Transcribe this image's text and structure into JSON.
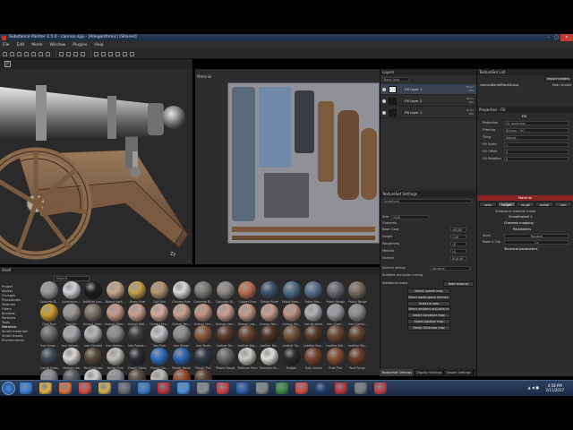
{
  "window": {
    "title": "Substance Painter 2.5.0 - cannon.spp - [Allegorithmic] [Shared]",
    "controls": [
      "–",
      "▢",
      "✕"
    ]
  },
  "menu": [
    "File",
    "Edit",
    "Mode",
    "Window",
    "Plugins",
    "Help"
  ],
  "viewport2d": {
    "label": "Material"
  },
  "shelf": {
    "title": "Shelf",
    "search_placeholder": "Search...",
    "categories": [
      "Project",
      "Alphas",
      "Grunges",
      "Procedurals",
      "Textures",
      "Filters",
      "Brushes",
      "Particles",
      "Tools",
      "Materials",
      "Smart materials",
      "Smart masks",
      "Environments"
    ],
    "selected_category": "Materials",
    "materials": [
      {
        "name": "Concrete D...",
        "color": "#9a9a98"
      },
      {
        "name": "Aluminium...",
        "color": "#cfd3d8"
      },
      {
        "name": "Artificial Lea...",
        "color": "#1c1c1c"
      },
      {
        "name": "Baked Light...",
        "color": "#caa98a"
      },
      {
        "name": "Brass Pure",
        "color": "#c8a24a"
      },
      {
        "name": "Calf Skin",
        "color": "#b8956f"
      },
      {
        "name": "Chrome Pure",
        "color": "#d8d8d8"
      },
      {
        "name": "Concrete Bl...",
        "color": "#7d7d78"
      },
      {
        "name": "Concrete Sl...",
        "color": "#8d8a85"
      },
      {
        "name": "Copper Pure",
        "color": "#c07050"
      },
      {
        "name": "Denim Rivet",
        "color": "#3d5570"
      },
      {
        "name": "Fabric Base...",
        "color": "#4e6e8a"
      },
      {
        "name": "Fabric Bas...",
        "color": "#58718e"
      },
      {
        "name": "Fabric Rough",
        "color": "#6a6a72"
      },
      {
        "name": "Fabric Rough",
        "color": "#7a6e62"
      },
      {
        "name": "Gold Pure",
        "color": "#d0a030"
      },
      {
        "name": "Granite",
        "color": "#9c9994"
      },
      {
        "name": "Ground Grav...",
        "color": "#7a7365"
      },
      {
        "name": "Human Back...",
        "color": "#c79a86"
      },
      {
        "name": "Human Bell...",
        "color": "#c9a08e"
      },
      {
        "name": "Human Eye...",
        "color": "#d2ab9a"
      },
      {
        "name": "Human Fac...",
        "color": "#caa090"
      },
      {
        "name": "Human Fee...",
        "color": "#c49583"
      },
      {
        "name": "Human Hea...",
        "color": "#c89c8a"
      },
      {
        "name": "Human Leg...",
        "color": "#c49a88"
      },
      {
        "name": "Human Nec...",
        "color": "#c89d8b"
      },
      {
        "name": "Human Shi...",
        "color": "#c29584"
      },
      {
        "name": "Iron Brushed",
        "color": "#b0b2b6"
      },
      {
        "name": "Iron Chain...",
        "color": "#9a9ba0"
      },
      {
        "name": "Iron Diamo...",
        "color": "#8d8e92"
      },
      {
        "name": "Iron Forge...",
        "color": "#6d6c6c"
      },
      {
        "name": "Iron Galvan...",
        "color": "#a4a7ab"
      },
      {
        "name": "Iron Grinded",
        "color": "#b6b7ba"
      },
      {
        "name": "Iron Hamm...",
        "color": "#8a8b8f"
      },
      {
        "name": "Iron Powde...",
        "color": "#3d3d3d"
      },
      {
        "name": "Iron Pure",
        "color": "#c4c5c9"
      },
      {
        "name": "Iron Rough",
        "color": "#8c8c8c"
      },
      {
        "name": "Iron Rusty",
        "color": "#8a5a3a"
      },
      {
        "name": "Leather Ba...",
        "color": "#5d3d28"
      },
      {
        "name": "Leather Big...",
        "color": "#6a4630"
      },
      {
        "name": "Leather Me...",
        "color": "#4e3020"
      },
      {
        "name": "Leather Ro...",
        "color": "#73533a"
      },
      {
        "name": "Leather Sea...",
        "color": "#5a3b25"
      },
      {
        "name": "Leather Sof...",
        "color": "#704a32"
      },
      {
        "name": "Leather Sty...",
        "color": "#664230"
      },
      {
        "name": "Liquid Grass",
        "color": "#3d4a55"
      },
      {
        "name": "Marble Line",
        "color": "#d8d6d2"
      },
      {
        "name": "Mud Cracked",
        "color": "#5a4a38"
      },
      {
        "name": "Nickel Pure",
        "color": "#c2c0b8"
      },
      {
        "name": "Plastic Fabric",
        "color": "#2a2a30"
      },
      {
        "name": "Plastic Glo...",
        "color": "#2f6fc4"
      },
      {
        "name": "Plastic Matte",
        "color": "#2c68b8"
      },
      {
        "name": "Plastic PVC",
        "color": "#303845"
      },
      {
        "name": "Plastic Rough",
        "color": "#6a6a6a"
      },
      {
        "name": "Platinum Pure",
        "color": "#cccbc6"
      },
      {
        "name": "Porcelain Bl...",
        "color": "#e0ded8"
      },
      {
        "name": "Rubber",
        "color": "#2a2a2a"
      },
      {
        "name": "Rust Coarse",
        "color": "#7a4428"
      },
      {
        "name": "Rust Fine",
        "color": "#8a4e30"
      },
      {
        "name": "Rust Rough",
        "color": "#6e3e26"
      },
      {
        "name": "Silk Artificial",
        "color": "#8a8a92"
      },
      {
        "name": "Silicone Coat",
        "color": "#555a60"
      },
      {
        "name": "Silver Pure",
        "color": "#d4d4d6"
      },
      {
        "name": "Steel Rough",
        "color": "#95969a"
      },
      {
        "name": "Steel Rust Sc...",
        "color": "#5a4a40"
      },
      {
        "name": "Titanium Pure",
        "color": "#bdbcb8"
      },
      {
        "name": "Wood Walnut",
        "color": "#9a4a2a"
      },
      {
        "name": "Wood Vene...",
        "color": "#5a3b2a"
      }
    ]
  },
  "layers": {
    "title": "Layers",
    "channel": "Base Color",
    "items": [
      {
        "name": "Fill layer 1",
        "mode": "Norm",
        "opacity": "100",
        "selected": true
      },
      {
        "name": "Fill layer 2",
        "mode": "Norm",
        "opacity": "100",
        "selected": false
      },
      {
        "name": "Fill layer 1",
        "mode": "Norm",
        "opacity": "100",
        "selected": false
      }
    ]
  },
  "texture_set_settings": {
    "title": "TextureSet Settings",
    "texset_name": "Undefined",
    "size_label": "Size",
    "size_value": "2048",
    "channels_label": "Channels",
    "channels": [
      {
        "name": "Base Color",
        "format": "sRGB8"
      },
      {
        "name": "Height",
        "format": "L16F"
      },
      {
        "name": "Roughness",
        "format": "L8"
      },
      {
        "name": "Metallic",
        "format": "L8"
      },
      {
        "name": "Normal",
        "format": "RGB16F"
      }
    ],
    "normal_mixing_label": "Normal mixing",
    "normal_mixing_value": "Combine",
    "ao_label": "Ambient occlusion mixing",
    "additional_maps_label": "Additional maps",
    "bake_button": "Bake textures",
    "map_buttons": [
      "Select normal map",
      "Select world space normal map",
      "Select id map",
      "Select ambient occlusion map",
      "Select curvature map",
      "Select position map",
      "Select thickness map"
    ],
    "bottom_tabs": [
      "TextureSet Settings",
      "Display Settings",
      "Viewer Settings"
    ]
  },
  "texture_set_list": {
    "title": "TextureSet List",
    "import_button": "Import shaders",
    "item": "cannonBarrelBlackGroup",
    "shader": "Main shader"
  },
  "properties": {
    "title": "Properties - Fill",
    "section": "Fill",
    "projection_label": "Projection",
    "projection_value": "UV projection",
    "filtering_label": "Filtering",
    "filtering_value": "Bilinear | HQ",
    "tiling_label": "Tiling",
    "tiling_value": "Repeat",
    "uv_scale_label": "UV Scale",
    "uv_scale_value": "1",
    "uv_offset_label": "UV Offset",
    "uv_offset_value": "0",
    "uv_rotation_label": "UV Rotation",
    "uv_rotation_value": "0",
    "material_bar": "Material",
    "channel_tabs": [
      "color",
      "height",
      "rough",
      "metal",
      "nrm"
    ],
    "substance_label": "Substance material mode",
    "substance_value": "Smoothwood 1",
    "channels_mapping": "Channels mapping",
    "parameters": "Parameters",
    "seed_label": "Seed",
    "seed_value": "Random",
    "make_it_tile_label": "Make It Tile",
    "make_it_tile_value": "On",
    "technical_parameters": "Technical parameters"
  },
  "taskbar": {
    "time": "4:58 PM",
    "date": "2/11/2017",
    "tray": "▲ ◀ ■",
    "apps": [
      {
        "name": "ie",
        "color": "#3b7ed8"
      },
      {
        "name": "explorer",
        "color": "#e0b040"
      },
      {
        "name": "media",
        "color": "#e07030"
      },
      {
        "name": "chrome",
        "color": "#d84b3a"
      },
      {
        "name": "folder",
        "color": "#d9b04a"
      },
      {
        "name": "app6",
        "color": "#6a6a6a"
      },
      {
        "name": "app7",
        "color": "#3a7ac8"
      },
      {
        "name": "app8",
        "color": "#c03030"
      },
      {
        "name": "app9",
        "color": "#4a90d8"
      },
      {
        "name": "app10",
        "color": "#8a8a8a"
      },
      {
        "name": "app11",
        "color": "#d04040"
      },
      {
        "name": "app12",
        "color": "#2a5aa8"
      },
      {
        "name": "app13",
        "color": "#888888"
      },
      {
        "name": "app14",
        "color": "#3a8a3a"
      },
      {
        "name": "chrome2",
        "color": "#d84b3a"
      },
      {
        "name": "ps",
        "color": "#1a3a6a"
      },
      {
        "name": "app17",
        "color": "#c03030"
      },
      {
        "name": "app18",
        "color": "#7a7a7a"
      },
      {
        "name": "app19",
        "color": "#c04040"
      }
    ]
  }
}
